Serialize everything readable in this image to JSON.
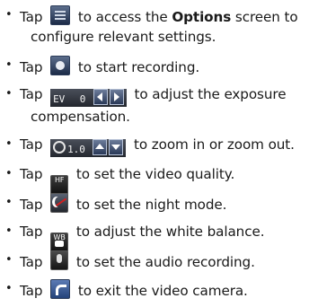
{
  "items": [
    {
      "pre": "Tap",
      "post_a": "to access the",
      "bold": "Options",
      "post_b": "screen to",
      "line2": "configure relevant settings.",
      "icon": "options-list-icon"
    },
    {
      "pre": "Tap",
      "post": "to start recording.",
      "icon": "record-icon"
    },
    {
      "pre": "Tap",
      "ev_label": "EV",
      "ev_value": "0",
      "post": "to adjust the exposure",
      "line2": "compensation.",
      "icon": "exposure-control-icon"
    },
    {
      "pre": "Tap",
      "zoom_value": "1.0",
      "post": "to zoom in or zoom out.",
      "icon": "zoom-control-icon"
    },
    {
      "pre": "Tap",
      "post": "to set the video quality.",
      "icon": "video-quality-icon",
      "icon_text": "HF"
    },
    {
      "pre": "Tap",
      "post": "to set the night mode.",
      "icon": "night-mode-icon"
    },
    {
      "pre": "Tap",
      "post": "to adjust the white balance.",
      "icon": "white-balance-icon",
      "icon_text": "WB"
    },
    {
      "pre": "Tap",
      "post": "to set the audio recording.",
      "icon": "microphone-icon"
    },
    {
      "pre": "Tap",
      "post": "to exit the video camera.",
      "icon": "exit-icon"
    }
  ],
  "bullet": "•"
}
